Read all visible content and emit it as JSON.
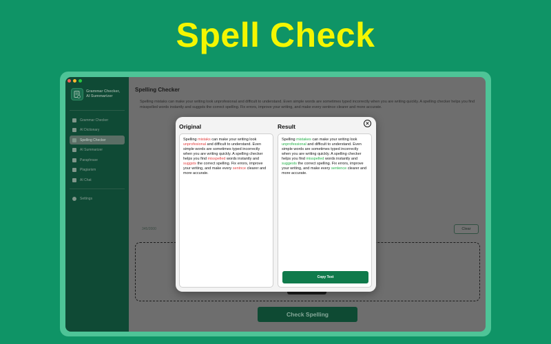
{
  "headline": "Spell Check",
  "colors": {
    "background": "#0f9466",
    "headline": "#f4f600",
    "accent": "#0f7a4b",
    "error": "#e03b3b",
    "correct": "#1fae45"
  },
  "app": {
    "title_line1": "Grammar Checker,",
    "title_line2": "AI Summarizer",
    "logo_icon": "document-check-icon"
  },
  "sidebar": {
    "items": [
      {
        "label": "Grammar Checker",
        "icon": "grammar-icon"
      },
      {
        "label": "AI Dictionary",
        "icon": "dictionary-icon"
      },
      {
        "label": "Spelling Checker",
        "icon": "spelling-icon",
        "active": true
      },
      {
        "label": "AI Summarizer",
        "icon": "summarizer-icon"
      },
      {
        "label": "Paraphrase",
        "icon": "paraphrase-icon"
      },
      {
        "label": "Plagiarism",
        "icon": "plagiarism-icon"
      },
      {
        "label": "AI Chat",
        "icon": "chat-icon"
      }
    ],
    "settings_label": "Settings"
  },
  "main": {
    "title": "Spelling Checker",
    "input_text": "Spelling mistaks can make your writing look unprofesional and difficult to understand. Even simple words are sometimes typed incorrectly when you are writing quickly. A spelling checker helps you find misspelled words instantly and suggsts the correct spelling. Fix errors, improve your writing, and make every sentnce clearer and more accurate.",
    "counter": "345/2000",
    "clear_label": "Clear",
    "check_label": "Check Spelling"
  },
  "modal": {
    "original_title": "Original",
    "result_title": "Result",
    "close_icon": "close-icon",
    "original": {
      "p1": "Spelling ",
      "e1": "mistaks",
      "p2": " can make your writing look ",
      "e2": "unprofesional",
      "p3": " and difficult to understand. Even simple words are sometimes typed incorrectly when you are writing quickly. A spelling checker helps you find ",
      "e3": "misspelled",
      "p4": " words instantly and ",
      "e4": "suggsts",
      "p5": " the correct spelling. Fix errors, improve your writing, and make every ",
      "e5": "sentnce",
      "p6": " clearer and more accurate."
    },
    "result": {
      "p1": "Spelling ",
      "c1": "mistakes",
      "p2": " can make your writing look ",
      "c2": "unprofessional",
      "p3": " and difficult to understand. Even simple words are sometimes typed incorrectly when you are writing quickly. A spelling checker helps you find ",
      "c3": "misspelled",
      "p4": " words instantly and ",
      "c4": "suggests",
      "p5": " the correct spelling. Fix errors, improve your writing, and make every ",
      "c5": "sentence",
      "p6": " clearer and more accurate."
    },
    "copy_label": "Copy Text"
  }
}
